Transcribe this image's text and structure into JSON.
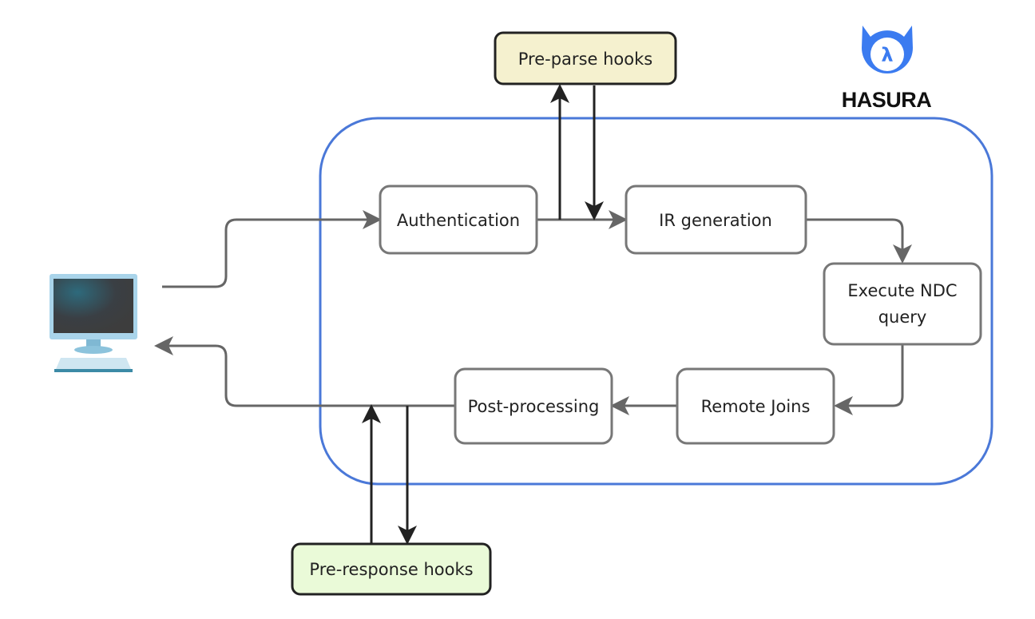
{
  "diagram": {
    "logo": {
      "text": "HASURA",
      "color": "#3b7bf0"
    },
    "client_icon": "desktop-computer-icon",
    "container_color": "#4a78d8",
    "nodes": {
      "pre_parse_hooks": {
        "label": "Pre-parse hooks",
        "fill": "#f5f1cf"
      },
      "authentication": {
        "label": "Authentication"
      },
      "ir_generation": {
        "label": "IR generation"
      },
      "execute_ndc_query": {
        "line1": "Execute NDC",
        "line2": "query"
      },
      "remote_joins": {
        "label": "Remote Joins"
      },
      "post_processing": {
        "label": "Post-processing"
      },
      "pre_response_hooks": {
        "label": "Pre-response hooks",
        "fill": "#eafad8"
      }
    },
    "edges": [
      {
        "from": "client",
        "to": "authentication"
      },
      {
        "from": "authentication",
        "to": "ir_generation"
      },
      {
        "from": "authentication",
        "to": "pre_parse_hooks"
      },
      {
        "from": "pre_parse_hooks",
        "to": "ir_generation"
      },
      {
        "from": "ir_generation",
        "to": "execute_ndc_query"
      },
      {
        "from": "execute_ndc_query",
        "to": "remote_joins"
      },
      {
        "from": "remote_joins",
        "to": "post_processing"
      },
      {
        "from": "post_processing",
        "to": "client"
      },
      {
        "from": "pre_response_hooks",
        "to": "post_processing"
      },
      {
        "from": "post_processing",
        "to": "pre_response_hooks"
      }
    ]
  }
}
